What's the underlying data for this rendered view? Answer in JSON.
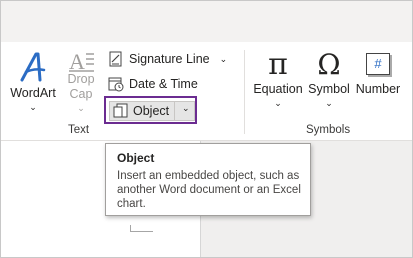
{
  "ribbon": {
    "text_group": {
      "label": "Text",
      "wordart": {
        "label": "WordArt",
        "chevron": "⌄"
      },
      "dropcap": {
        "label_line1": "Drop",
        "label_line2": "Cap",
        "chevron": "⌄"
      },
      "signature_line": {
        "label": "Signature Line",
        "chevron": "⌄",
        "icon": "signature-line-icon"
      },
      "date_time": {
        "label": "Date & Time",
        "icon": "calendar-clock-icon"
      },
      "object": {
        "label": "Object",
        "chevron": "⌄",
        "icon": "object-icon"
      }
    },
    "symbols_group": {
      "label": "Symbols",
      "equation": {
        "label": "Equation",
        "chevron": "⌄",
        "glyph": "π"
      },
      "symbol": {
        "label": "Symbol",
        "chevron": "⌄",
        "glyph": "Ω"
      },
      "number": {
        "label": "Number",
        "glyph": "#"
      }
    }
  },
  "tooltip": {
    "title": "Object",
    "body": "Insert an embedded object, such as another Word document or an Excel chart."
  },
  "colors": {
    "highlight_border": "#6b2c91",
    "wordart_blue": "#2b6cc4",
    "disabled_text": "#a19f9d"
  }
}
